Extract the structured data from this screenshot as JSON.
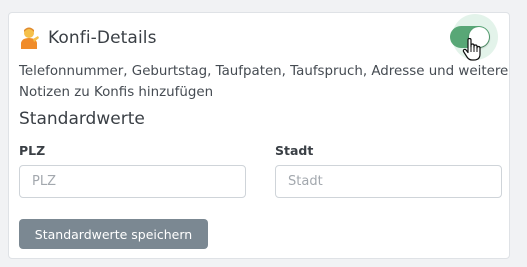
{
  "section": {
    "title": "Konfi-Details",
    "emoji_icon": "person-tipping-hand-emoji",
    "toggle_on": true,
    "description": "Telefonnummer, Geburtstag, Taufpaten, Taufspruch, Adresse und weitere Notizen zu Konfis hinzufügen"
  },
  "defaults": {
    "title": "Standardwerte",
    "plz": {
      "label": "PLZ",
      "value": "",
      "placeholder": "PLZ"
    },
    "stadt": {
      "label": "Stadt",
      "value": "",
      "placeholder": "Stadt"
    },
    "save_label": "Standardwerte speichern"
  },
  "colors": {
    "toggle_active": "#58a776",
    "button_bg": "#7b8892"
  }
}
